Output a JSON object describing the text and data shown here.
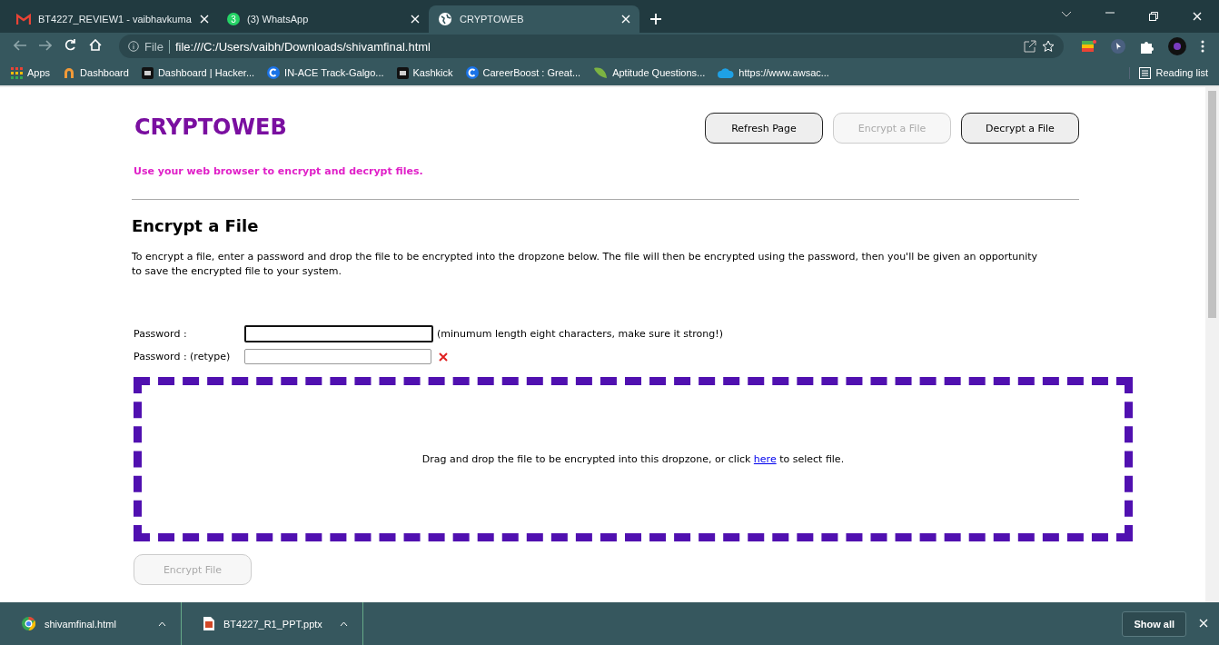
{
  "tabs": [
    {
      "title": "BT4227_REVIEW1 - vaibhavkuma",
      "kind": "mail",
      "selected": false
    },
    {
      "title": "(3) WhatsApp",
      "kind": "chat",
      "badge": "3",
      "selected": false
    },
    {
      "title": "CRYPTOWEB",
      "kind": "globe",
      "selected": true
    }
  ],
  "address_bar": {
    "scheme": "File",
    "url": "file:///C:/Users/vaibh/Downloads/shivamfinal.html"
  },
  "bookmarks": [
    {
      "label": "Apps",
      "kind": "grid"
    },
    {
      "label": "Dashboard",
      "kind": "arch"
    },
    {
      "label": "Dashboard | Hacker...",
      "kind": "square"
    },
    {
      "label": "IN-ACE Track-Galgo...",
      "kind": "circle"
    },
    {
      "label": "Kashkick",
      "kind": "square"
    },
    {
      "label": "CareerBoost : Great...",
      "kind": "circle"
    },
    {
      "label": "Aptitude Questions...",
      "kind": "leaf"
    },
    {
      "label": "https://www.awsac...",
      "kind": "cloud"
    }
  ],
  "reading_list": "Reading list",
  "page": {
    "title": "CRYPTOWEB",
    "tagline": "Use your web browser to encrypt and decrypt files.",
    "nav_buttons": [
      {
        "label": "Refresh Page",
        "disabled": false
      },
      {
        "label": "Encrypt a File",
        "disabled": true
      },
      {
        "label": "Decrypt a File",
        "disabled": false
      }
    ],
    "heading": "Encrypt a File",
    "description": "To encrypt a file, enter a password and drop the file to be encrypted into the dropzone below. The file will then be encrypted using the password, then you'll be given an opportunity to save the encrypted file to your system.",
    "fields": [
      {
        "label": "Password :",
        "focused": true,
        "invalid": false,
        "note": "(minumum length eight characters, make sure it strong!)"
      },
      {
        "label": "Password : (retype)",
        "focused": false,
        "invalid": true
      }
    ],
    "dropzone": {
      "text_before": "Drag and drop the file to be encrypted into this dropzone, or click",
      "link": "here",
      "text_after": "to select file."
    },
    "submit": {
      "label": "Encrypt File",
      "disabled": true
    }
  },
  "downloads": [
    {
      "name": "shivamfinal.html",
      "kind": "chrome"
    },
    {
      "name": "BT4227_R1_PPT.pptx",
      "kind": "pptx"
    }
  ],
  "show_all": "Show all"
}
